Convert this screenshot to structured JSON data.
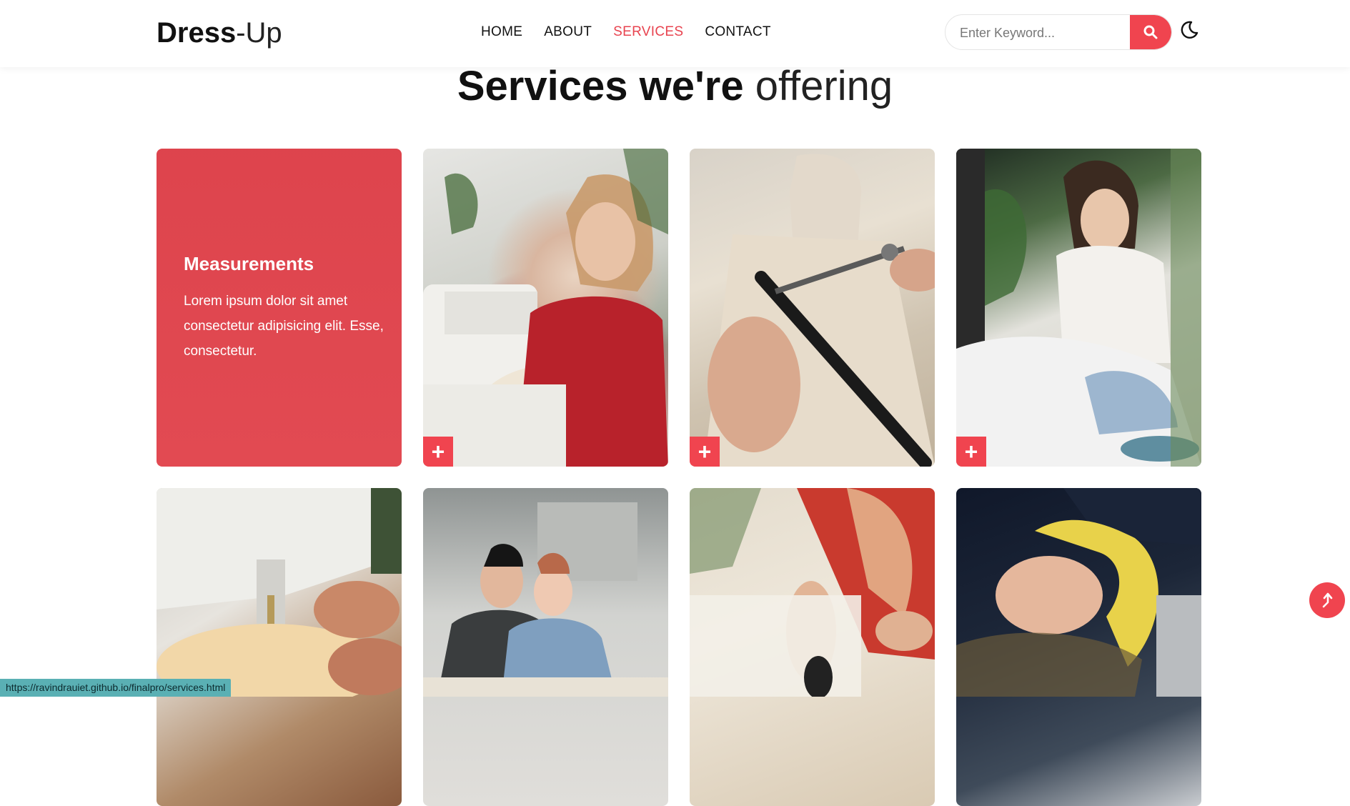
{
  "header": {
    "logo_bold": "Dress",
    "logo_light": "-Up",
    "nav": [
      {
        "label": "HOME",
        "active": false
      },
      {
        "label": "ABOUT",
        "active": false
      },
      {
        "label": "SERVICES",
        "active": true
      },
      {
        "label": "CONTACT",
        "active": false
      }
    ],
    "search_placeholder": "Enter Keyword...",
    "icons": {
      "search": "search-icon",
      "theme": "moon-icon"
    }
  },
  "main": {
    "title_bold": "Services we're",
    "title_light": "offering",
    "featured": {
      "title": "Measurements",
      "text": "Lorem ipsum dolor sit amet consectetur adipisicing elit. Esse, consectetur."
    },
    "cards": [
      {
        "image": "woman-sewing-machine-photo",
        "action_icon": "plus-icon"
      },
      {
        "image": "cutting-fabric-on-mannequin-photo",
        "action_icon": "plus-icon"
      },
      {
        "image": "woman-hand-sewing-photo",
        "action_icon": "plus-icon"
      },
      {
        "image": "sewing-machine-needle-photo"
      },
      {
        "image": "designers-at-table-photo"
      },
      {
        "image": "cutting-paper-pattern-photo"
      },
      {
        "image": "measuring-tape-hands-photo"
      }
    ]
  },
  "status_url": "https://ravindrauiet.github.io/finalpro/services.html",
  "colors": {
    "accent": "#f0444f",
    "status_bar": "#5ab0b4"
  }
}
